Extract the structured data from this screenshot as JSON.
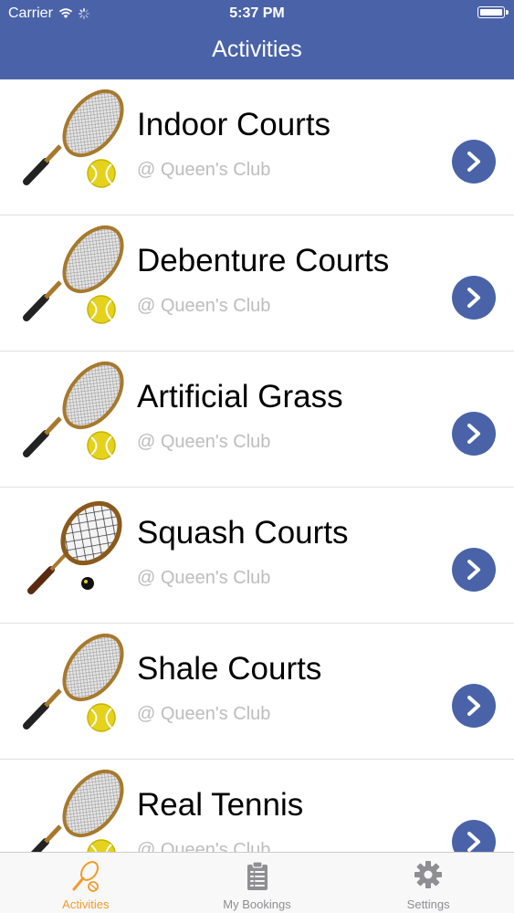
{
  "status": {
    "carrier": "Carrier",
    "time": "5:37 PM"
  },
  "nav": {
    "title": "Activities"
  },
  "activities": [
    {
      "name": "Indoor Courts",
      "venue": "@ Queen's Club",
      "icon": "tennis-racket-icon"
    },
    {
      "name": "Debenture Courts",
      "venue": "@ Queen's Club",
      "icon": "tennis-racket-icon"
    },
    {
      "name": "Artificial Grass",
      "venue": "@ Queen's Club",
      "icon": "tennis-racket-icon"
    },
    {
      "name": "Squash Courts",
      "venue": "@ Queen's Club",
      "icon": "squash-racket-icon"
    },
    {
      "name": "Shale Courts",
      "venue": "@ Queen's Club",
      "icon": "tennis-racket-icon"
    },
    {
      "name": "Real Tennis",
      "venue": "@ Queen's Club",
      "icon": "tennis-racket-icon"
    }
  ],
  "tabs": [
    {
      "label": "Activities",
      "icon": "tennis-racket-icon",
      "active": true
    },
    {
      "label": "My Bookings",
      "icon": "clipboard-icon",
      "active": false
    },
    {
      "label": "Settings",
      "icon": "gear-icon",
      "active": false
    }
  ],
  "colors": {
    "nav": "#4a63a8",
    "accent": "#f39a2b",
    "chevron": "#4a63a8",
    "subtitle": "#bdbdbd"
  }
}
